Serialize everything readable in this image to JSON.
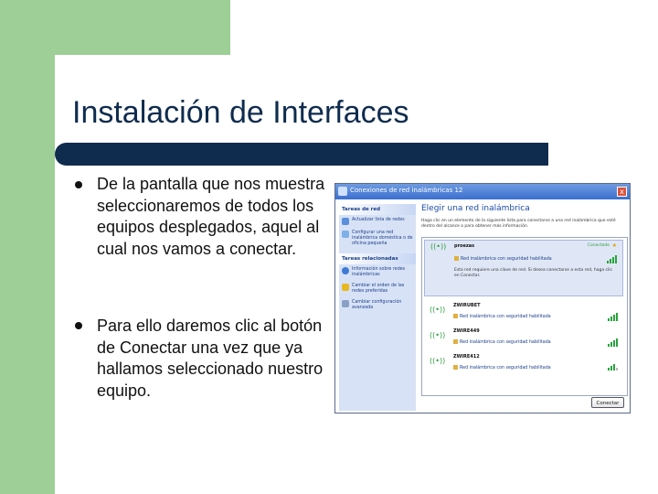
{
  "slide": {
    "title": "Instalación de Interfaces",
    "bullets": [
      "De la pantalla que nos muestra seleccionaremos de todos los equipos desplegados, aquel al cual nos vamos a conectar.",
      "Para ello daremos clic al botón de Conectar una vez que ya hallamos seleccionado nuestro equipo."
    ]
  },
  "dialog": {
    "title": "Conexiones de red inalámbricas 12",
    "close": "x",
    "sidebar": {
      "tasks_header": "Tareas de red",
      "tasks": [
        {
          "label": "Actualizar lista de redes",
          "icon": "refresh-icon"
        },
        {
          "label": "Configurar una red inalámbrica doméstica o de oficina pequeña",
          "icon": "network-setup-icon"
        }
      ],
      "related_header": "Tareas relacionadas",
      "related": [
        {
          "label": "Información sobre redes inalámbricas",
          "icon": "info-icon"
        },
        {
          "label": "Cambiar el orden de las redes preferidas",
          "icon": "star-icon"
        },
        {
          "label": "Cambiar configuración avanzada",
          "icon": "settings-icon"
        }
      ]
    },
    "heading": "Elegir una red inalámbrica",
    "description": "Haga clic en un elemento de la siguiente lista para conectarse a una red inalámbrica que esté dentro del alcance o para obtener más información.",
    "networks": [
      {
        "name": "proezas",
        "status": "Conectado",
        "security": "Red inalámbrica con seguridad habilitada",
        "details": "Esta red requiere una clave de red. Si desea conectarse a esta red, haga clic en Conectar.",
        "signal": 4,
        "selected": true
      },
      {
        "name": "ZWIRUBET",
        "security": "Red inalámbrica con seguridad habilitada",
        "signal": 4
      },
      {
        "name": "ZWIRE449",
        "security": "Red inalámbrica con seguridad habilitada",
        "signal": 4
      },
      {
        "name": "ZWIRE412",
        "security": "Red inalámbrica con seguridad habilitada",
        "signal": 3
      }
    ],
    "connect_label": "Conectar"
  },
  "colors": {
    "green_band": "#9dcf97",
    "navy": "#0f2c4e",
    "xp_blue": "#3b6fcf",
    "signal_green": "#28a33d"
  }
}
